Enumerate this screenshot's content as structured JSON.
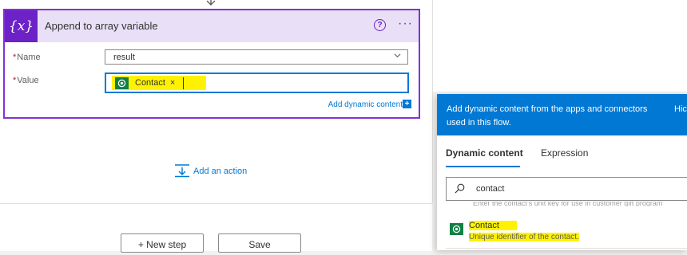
{
  "action_card": {
    "title": "Append to array variable",
    "icon_text": "{x}",
    "help": "?",
    "more": "···",
    "name_label": "Name",
    "name_value": "result",
    "value_label": "Value",
    "value_token": "Contact",
    "token_close": "×",
    "required_mark": "*",
    "add_dynamic_label": "Add dynamic content",
    "add_dynamic_icon": "+"
  },
  "canvas": {
    "add_action_label": "Add an action",
    "new_step_label": "+ New step",
    "save_label": "Save"
  },
  "dynamic_panel": {
    "header_line1": "Add dynamic content from the apps and connectors",
    "header_line2": "used in this flow.",
    "hide_label": "Hic",
    "tabs": [
      {
        "label": "Dynamic content",
        "active": true
      },
      {
        "label": "Expression",
        "active": false
      }
    ],
    "search_value": "contact",
    "hint_text": "Enter the contact's unit key for use in customer gift program",
    "results": [
      {
        "title": "Contact",
        "description": "Unique identifier of the contact."
      }
    ]
  },
  "colors": {
    "accent_purple": "#8231d6",
    "header_purple": "#e9e0f7",
    "blue": "#0078d4",
    "token_highlight": "#fff200",
    "dataverse_green": "#108043"
  }
}
